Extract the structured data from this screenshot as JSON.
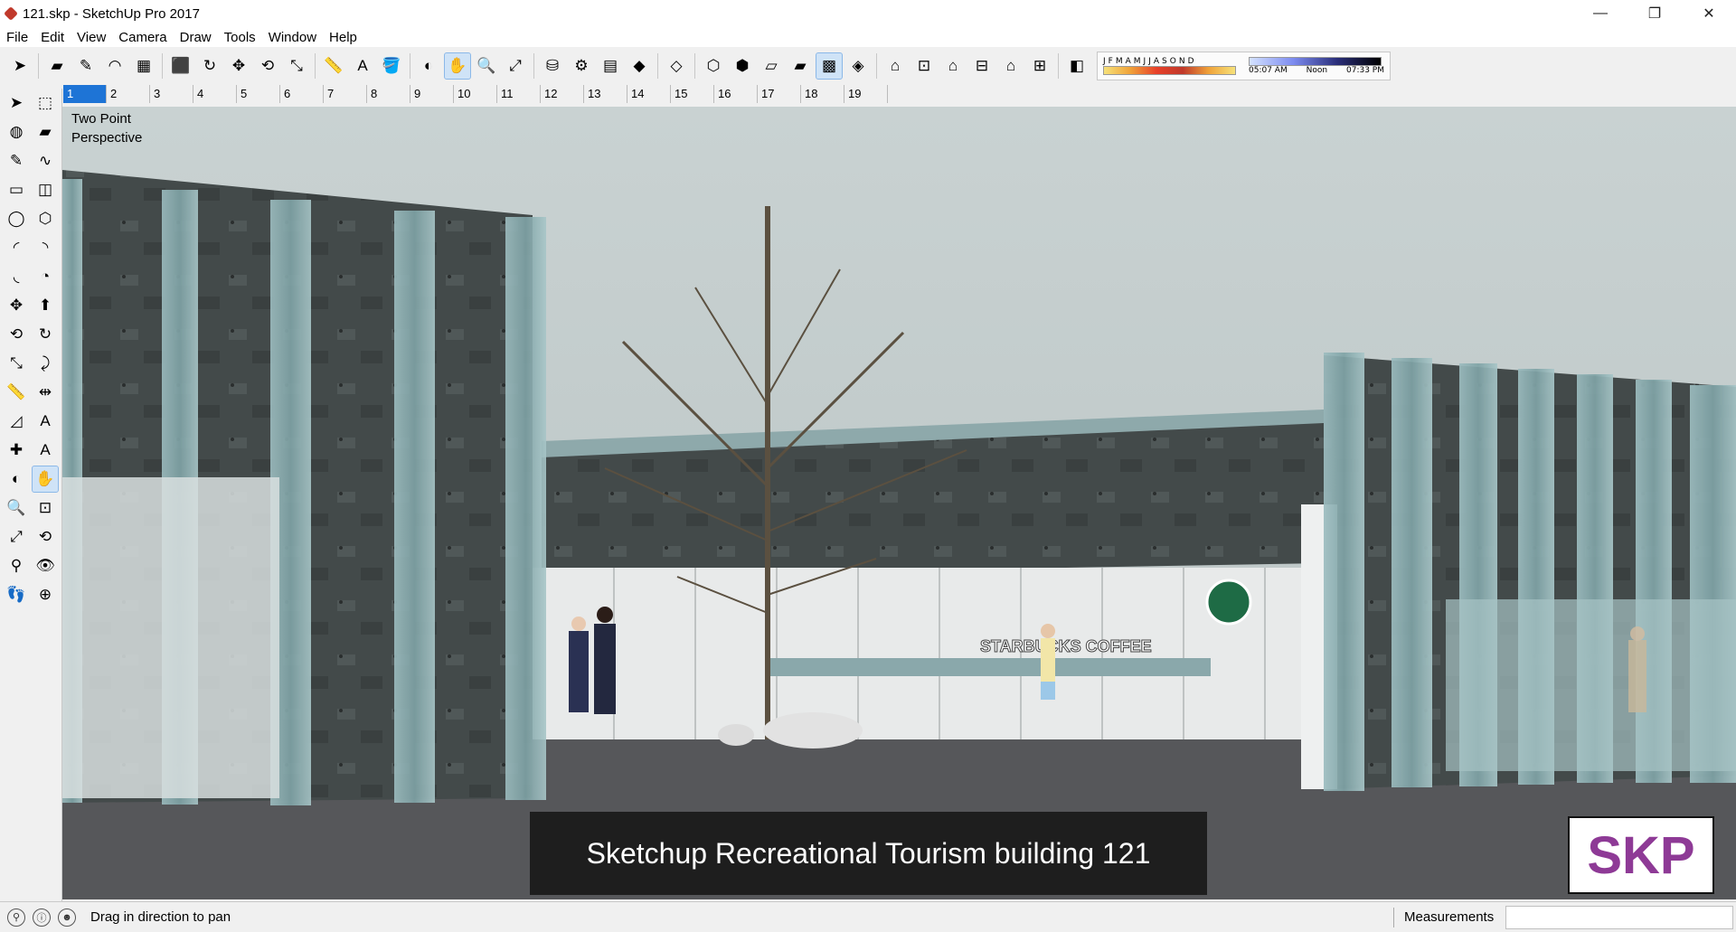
{
  "window": {
    "title": "121.skp - SketchUp Pro 2017",
    "minimize_icon": "minimize-icon",
    "maximize_icon": "restore-icon",
    "close_icon": "close-icon"
  },
  "menu": [
    "File",
    "Edit",
    "View",
    "Camera",
    "Draw",
    "Tools",
    "Window",
    "Help"
  ],
  "toolbar": {
    "tools": [
      {
        "name": "select-icon",
        "glyph": "➤"
      },
      {
        "name": "eraser-icon",
        "glyph": "▰"
      },
      {
        "name": "line-icon",
        "glyph": "✎"
      },
      {
        "name": "arc-icon",
        "glyph": "◠"
      },
      {
        "name": "rectangle-icon",
        "glyph": "▦"
      },
      {
        "name": "push-pull-icon",
        "glyph": "⬛"
      },
      {
        "name": "follow-me-icon",
        "glyph": "↻"
      },
      {
        "name": "move-icon",
        "glyph": "✥"
      },
      {
        "name": "rotate-icon",
        "glyph": "⟲"
      },
      {
        "name": "scale-icon",
        "glyph": "⤡"
      },
      {
        "name": "tape-measure-icon",
        "glyph": "📏"
      },
      {
        "name": "text-icon",
        "glyph": "A"
      },
      {
        "name": "paint-bucket-icon",
        "glyph": "🪣"
      },
      {
        "name": "orbit-icon",
        "glyph": "◐"
      },
      {
        "name": "pan-icon",
        "glyph": "✋",
        "active": true
      },
      {
        "name": "zoom-icon",
        "glyph": "🔍"
      },
      {
        "name": "zoom-extents-icon",
        "glyph": "⤢"
      },
      {
        "name": "warehouse-icon",
        "glyph": "⛁"
      },
      {
        "name": "extension-warehouse-icon",
        "glyph": "⚙"
      },
      {
        "name": "layout-icon",
        "glyph": "▤"
      },
      {
        "name": "ruby-icon",
        "glyph": "◆"
      },
      {
        "name": "xray-icon",
        "glyph": "◇"
      },
      {
        "name": "back-edges-icon",
        "glyph": "⬡"
      },
      {
        "name": "wireframe-icon",
        "glyph": "⬢"
      },
      {
        "name": "hidden-line-icon",
        "glyph": "▱"
      },
      {
        "name": "shaded-icon",
        "glyph": "▰"
      },
      {
        "name": "shaded-textures-icon",
        "glyph": "▩",
        "active": true
      },
      {
        "name": "monochrome-icon",
        "glyph": "◈"
      },
      {
        "name": "iso-view-icon",
        "glyph": "⌂"
      },
      {
        "name": "top-view-icon",
        "glyph": "⊡"
      },
      {
        "name": "front-view-icon",
        "glyph": "⌂"
      },
      {
        "name": "right-view-icon",
        "glyph": "⊟"
      },
      {
        "name": "back-view-icon",
        "glyph": "⌂"
      },
      {
        "name": "left-view-icon",
        "glyph": "⊞"
      },
      {
        "name": "shadows-icon",
        "glyph": "◧"
      }
    ],
    "shadow_months": [
      "J",
      "F",
      "M",
      "A",
      "M",
      "J",
      "J",
      "A",
      "S",
      "O",
      "N",
      "D"
    ],
    "time_start": "05:07 AM",
    "time_mid": "Noon",
    "time_end": "07:33 PM"
  },
  "scenes": [
    "1",
    "2",
    "3",
    "4",
    "5",
    "6",
    "7",
    "8",
    "9",
    "10",
    "11",
    "12",
    "13",
    "14",
    "15",
    "16",
    "17",
    "18",
    "19"
  ],
  "active_scene": "1",
  "left_tools": [
    [
      "select-icon",
      "➤",
      false,
      "component-icon",
      "⬚",
      false
    ],
    [
      "paint-bucket-icon",
      "◍",
      false,
      "eraser-icon",
      "▰",
      false
    ],
    [
      "line-icon",
      "✎",
      false,
      "freehand-icon",
      "∿",
      false
    ],
    [
      "rectangle-icon",
      "▭",
      false,
      "rotated-rectangle-icon",
      "◫",
      false
    ],
    [
      "circle-icon",
      "◯",
      false,
      "polygon-icon",
      "⬡",
      false
    ],
    [
      "arc-icon",
      "◜",
      false,
      "two-point-arc-icon",
      "◝",
      false
    ],
    [
      "three-point-arc-icon",
      "◟",
      false,
      "pie-icon",
      "◔",
      false
    ],
    [
      "move-icon",
      "✥",
      false,
      "push-pull-icon",
      "⬆",
      false
    ],
    [
      "rotate-icon",
      "⟲",
      false,
      "follow-me-icon",
      "↻",
      false
    ],
    [
      "scale-icon",
      "⤡",
      false,
      "offset-icon",
      "⤸",
      false
    ],
    [
      "tape-measure-icon",
      "📏",
      false,
      "dimension-icon",
      "⇹",
      false
    ],
    [
      "protractor-icon",
      "◿",
      false,
      "text-icon",
      "A",
      false
    ],
    [
      "axes-icon",
      "✚",
      false,
      "3d-text-icon",
      "A",
      false
    ],
    [
      "orbit-icon",
      "◐",
      false,
      "pan-icon",
      "✋",
      true
    ],
    [
      "zoom-icon",
      "🔍",
      false,
      "zoom-window-icon",
      "⊡",
      false
    ],
    [
      "zoom-extents-icon",
      "⤢",
      false,
      "previous-view-icon",
      "⟲",
      false
    ],
    [
      "position-camera-icon",
      "⚲",
      false,
      "look-around-icon",
      "👁",
      false
    ],
    [
      "walk-icon",
      "👣",
      false,
      "section-plane-icon",
      "⊕",
      false
    ]
  ],
  "viewport": {
    "camera_label_line1": "Two Point",
    "camera_label_line2": "Perspective",
    "sign_text": "STARBUCKS COFFEE",
    "caption": "Sketchup Recreational Tourism building 121",
    "badge": "SKP"
  },
  "status": {
    "icons": [
      "geo-location-icon",
      "credits-icon",
      "user-icon"
    ],
    "message": "Drag in direction to pan",
    "measurements_label": "Measurements",
    "measurements_value": ""
  },
  "colors": {
    "sky": "#c6cfce",
    "dark_panel": "#3f4646",
    "glass": "#8fb1b4",
    "ground": "#57585a",
    "selection_blue": "#1e74d6",
    "badge_text": "#8e3a96"
  }
}
